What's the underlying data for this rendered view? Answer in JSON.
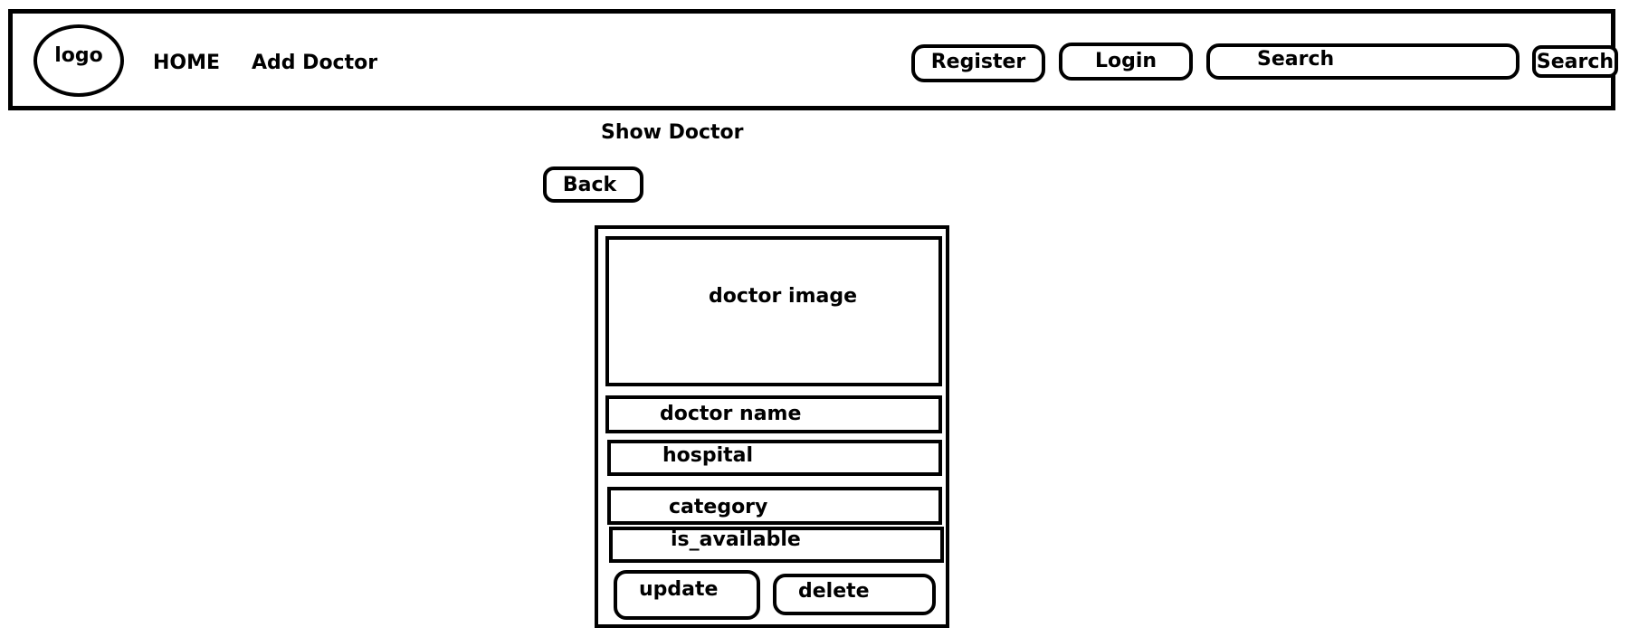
{
  "header": {
    "logo_label": "logo",
    "nav": {
      "home": "HOME",
      "add_doctor": "Add Doctor"
    },
    "register_label": "Register",
    "login_label": "Login",
    "search": {
      "placeholder": "Search",
      "button_label": "Search"
    }
  },
  "page": {
    "title": "Show Doctor",
    "back_label": "Back"
  },
  "doctor_card": {
    "image_label": "doctor image",
    "fields": {
      "name": "doctor name",
      "hospital": "hospital",
      "category": "category",
      "is_available": "is_available"
    },
    "update_label": "update",
    "delete_label": "delete"
  }
}
